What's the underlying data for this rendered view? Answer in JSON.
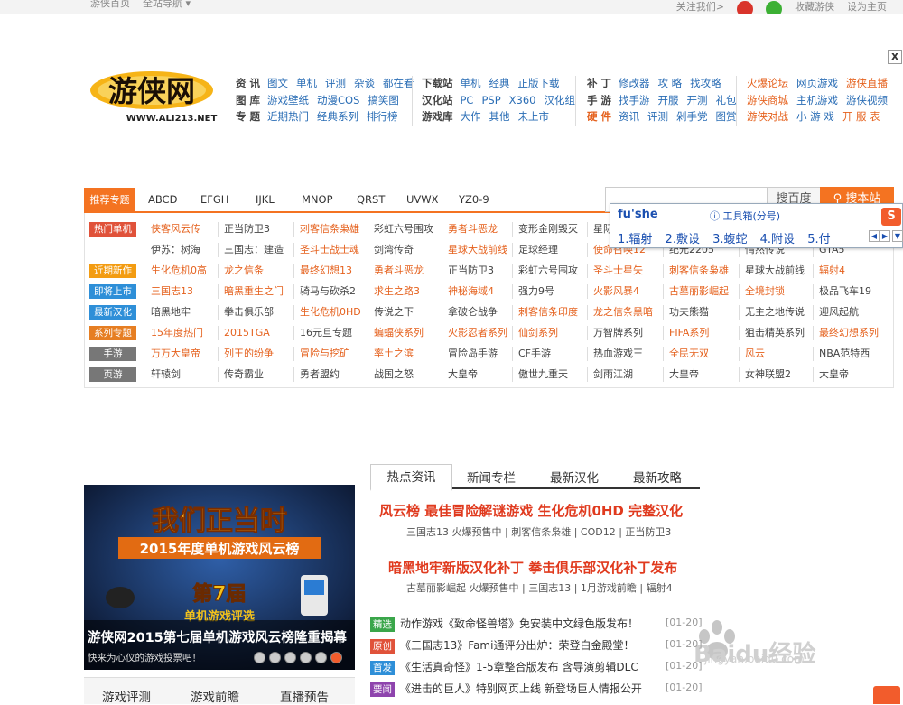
{
  "topbar": {
    "left": [
      "游侠首页",
      "全站导航 ▾"
    ],
    "right": [
      "关注我们>",
      "收藏游侠",
      "设为主页"
    ]
  },
  "close_label": "x",
  "logo": {
    "text": "游侠网",
    "url": "WWW.ALI213.NET"
  },
  "nav": {
    "col1": [
      {
        "head": "资 讯",
        "links": [
          "图文",
          "单机",
          "评测",
          "杂谈",
          "都在看"
        ]
      },
      {
        "head": "图 库",
        "links": [
          "游戏壁纸",
          "动漫COS",
          "搞笑图"
        ]
      },
      {
        "head": "专 题",
        "links": [
          "近期热门",
          "经典系列",
          "排行榜"
        ]
      }
    ],
    "col2": [
      {
        "head": "下载站",
        "links": [
          "单机",
          "经典",
          "正版下载"
        ]
      },
      {
        "head": "汉化站",
        "links": [
          "PC",
          "PSP",
          "X360",
          "汉化组"
        ]
      },
      {
        "head": "游戏库",
        "links": [
          "大作",
          "其他",
          "未上市"
        ]
      }
    ],
    "col3": [
      {
        "head": "补 丁",
        "links": [
          "修改器",
          "攻 略",
          "找攻略"
        ]
      },
      {
        "head": "手 游",
        "links": [
          "找手游",
          "开服",
          "开测",
          "礼包"
        ]
      },
      {
        "head": "硬 件",
        "links": [
          "资讯",
          "评测",
          "剁手党",
          "图赏"
        ]
      }
    ],
    "col4": [
      {
        "links": [
          "火爆论坛",
          "网页游戏",
          "游侠直播"
        ]
      },
      {
        "links": [
          "游侠商城",
          "主机游戏",
          "游侠视频"
        ]
      },
      {
        "links": [
          "游侠对战",
          "小 游 戏",
          "开 服 表"
        ]
      }
    ]
  },
  "tabs": {
    "recommend": "推荐专题",
    "items": [
      "ABCD",
      "EFGH",
      "IJKL",
      "MNOP",
      "QRST",
      "UVWX",
      "YZ0-9"
    ]
  },
  "search": {
    "btn_baidu": "搜百度",
    "btn_site": "搜本站"
  },
  "ime": {
    "pinyin": "fu'she",
    "toolbox": "工具箱(分号)",
    "candidates": [
      "1.辐射",
      "2.敷设",
      "3.蝮蛇",
      "4.附设",
      "5.付"
    ]
  },
  "games": {
    "rows": [
      {
        "label": "热门单机",
        "color": "#e0523a",
        "items": [
          "侠客风云传",
          "正当防卫3",
          "刺客信条枭雄",
          "彩虹六号围攻",
          "勇者斗恶龙",
          "变形金刚毁灭",
          "星际"
        ]
      },
      {
        "label": "",
        "color": "",
        "items": [
          "伊苏：树海",
          "三国志：建造",
          "圣斗士战士魂",
          "剑湾传奇",
          "星球大战前线",
          "足球经理",
          "使命召唤12",
          "纪元2205",
          "情然传说",
          "GTA5"
        ]
      },
      {
        "label": "近期新作",
        "color": "#f39c12",
        "items": [
          "生化危机0高",
          "龙之信条",
          "最终幻想13",
          "勇者斗恶龙",
          "正当防卫3",
          "彩虹六号围攻",
          "圣斗士星矢",
          "刺客信条枭雄",
          "星球大战前线",
          "辐射4"
        ]
      },
      {
        "label": "即将上市",
        "color": "#2e8fd8",
        "items": [
          "三国志13",
          "暗黑重生之门",
          "骑马与砍杀2",
          "求生之路3",
          "神秘海域4",
          "强力9号",
          "火影风暴4",
          "古墓丽影崛起",
          "全境封锁",
          "极品飞车19"
        ]
      },
      {
        "label": "最新汉化",
        "color": "#2e8fd8",
        "items": [
          "暗黑地牢",
          "拳击俱乐部",
          "生化危机0HD",
          "传说之下",
          "拿破仑战争",
          "刺客信条印度",
          "龙之信条黑暗",
          "功夫熊猫",
          "无主之地传说",
          "迎风起航"
        ]
      },
      {
        "label": "系列专题",
        "color": "#e67e22",
        "items": [
          "15年度热门",
          "2015TGA",
          "16元旦专题",
          "蝙蝠侠系列",
          "火影忍者系列",
          "仙剑系列",
          "万智牌系列",
          "FIFA系列",
          "狙击精英系列",
          "最终幻想系列"
        ]
      },
      {
        "label": "手游",
        "color": "#777",
        "items": [
          "万万大皇帝",
          "列王的纷争",
          "冒险与挖矿",
          "率土之滨",
          "冒险岛手游",
          "CF手游",
          "热血游戏王",
          "全民无双",
          "风云",
          "NBA范特西"
        ]
      },
      {
        "label": "页游",
        "color": "#777",
        "items": [
          "轩辕剑",
          "传奇霸业",
          "勇者盟约",
          "战国之怒",
          "大皇帝",
          "傲世九重天",
          "剑雨江湖",
          "大皇帝",
          "女神联盟2",
          "大皇帝"
        ]
      }
    ]
  },
  "news": {
    "tabs": [
      "热点资讯",
      "新闻专栏",
      "最新汉化",
      "最新攻略"
    ],
    "headline1": "风云榜 最佳冒险解谜游戏   生化危机0HD 完整汉化",
    "sub1": "三国志13 火爆预售中 | 刺客信条枭雄 | COD12 | 正当防卫3",
    "headline2": "暗黑地牢新版汉化补丁    拳击俱乐部汉化补丁发布",
    "sub2": "古墓丽影崛起 火爆预售中 | 三国志13 | 1月游戏前瞻 | 辐射4",
    "items": [
      {
        "tag": "精选",
        "color": "#3aa64a",
        "text": "动作游戏《致命怪兽塔》免安装中文绿色版发布！",
        "date": "[01-20]"
      },
      {
        "tag": "原创",
        "color": "#e0523a",
        "text": "《三国志13》Fami通评分出炉：荣登白金殿堂！",
        "date": "[01-20]"
      },
      {
        "tag": "首发",
        "color": "#2e8fd8",
        "text": "《生活真奇怪》1-5章整合版发布 含导演剪辑DLC",
        "date": "[01-20]"
      },
      {
        "tag": "要闻",
        "color": "#8e44ad",
        "text": "《进击的巨人》特别网页上线 新登场巨人情报公开",
        "date": "[01-20]"
      }
    ]
  },
  "banner": {
    "big1": "我们正当时",
    "big2": "2015年度单机游戏风云榜",
    "big3": "第7届",
    "big4": "单机游戏评选",
    "title": "游侠网2015第七届单机游戏风云榜隆重揭幕",
    "subtitle": "快来为心仪的游戏投票吧！",
    "dots": 6
  },
  "bottom_tabs": [
    "游戏评测",
    "游戏前瞻",
    "直播预告"
  ],
  "watermark": {
    "brand": "Baidu经验",
    "url": "jingyan.baidu.com"
  }
}
